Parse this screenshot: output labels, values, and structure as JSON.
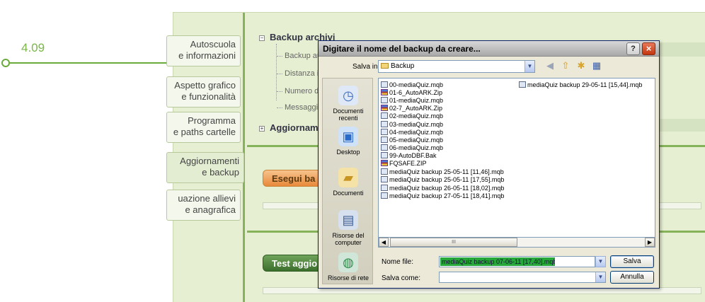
{
  "callout": {
    "label": "4.09"
  },
  "sidebar": {
    "items": [
      {
        "line1": "Autoscuola",
        "line2": "e informazioni"
      },
      {
        "line1": "Aspetto grafico",
        "line2": "e funzionalità"
      },
      {
        "line1": "Programma",
        "line2": "e paths cartelle"
      },
      {
        "line1": "Aggiornamenti",
        "line2": "e backup"
      },
      {
        "line1": "uazione allievi",
        "line2": "e anagrafica"
      }
    ],
    "active_index": 3
  },
  "content": {
    "tree": {
      "group1_title": "Backup archivi",
      "group1_items": [
        "Backup au",
        "Distanza i",
        "Numero di",
        "Messaggio"
      ],
      "group2_title": "Aggiornam"
    },
    "backup_button": "Esegui ba",
    "test_button": "Test aggio"
  },
  "dialog": {
    "title": "Digitare il nome del backup da creare...",
    "help": "?",
    "close": "×",
    "save_in_label": "Salva in:",
    "save_in_value": "Backup",
    "places": [
      "Documenti recenti",
      "Desktop",
      "Documenti",
      "Risorse del computer",
      "Risorse di rete"
    ],
    "files_col1": [
      {
        "name": "00-mediaQuiz.mqb",
        "type": "mqb"
      },
      {
        "name": "01-6_AutoARK.Zip",
        "type": "zip"
      },
      {
        "name": "01-mediaQuiz.mqb",
        "type": "mqb"
      },
      {
        "name": "02-7_AutoARK.Zip",
        "type": "zip"
      },
      {
        "name": "02-mediaQuiz.mqb",
        "type": "mqb"
      },
      {
        "name": "03-mediaQuiz.mqb",
        "type": "mqb"
      },
      {
        "name": "04-mediaQuiz.mqb",
        "type": "mqb"
      },
      {
        "name": "05-mediaQuiz.mqb",
        "type": "mqb"
      },
      {
        "name": "06-mediaQuiz.mqb",
        "type": "mqb"
      },
      {
        "name": "99-AutoDBF.Bak",
        "type": "mqb"
      },
      {
        "name": "FQSAFE.ZIP",
        "type": "zip"
      },
      {
        "name": "mediaQuiz backup 25-05-11 [11,46].mqb",
        "type": "mqb"
      },
      {
        "name": "mediaQuiz backup 25-05-11 [17,55].mqb",
        "type": "mqb"
      },
      {
        "name": "mediaQuiz backup 26-05-11 [18,02].mqb",
        "type": "mqb"
      },
      {
        "name": "mediaQuiz backup 27-05-11 [18,41].mqb",
        "type": "mqb"
      }
    ],
    "files_col2": [
      {
        "name": "mediaQuiz backup 29-05-11 [15,44].mqb",
        "type": "mqb"
      }
    ],
    "scroll_thumb": "III",
    "filename_label": "Nome file:",
    "filename_value": "mediaQuiz backup 07-06-11 [17,40].mqb",
    "savetype_label": "Salva come:",
    "savetype_value": "",
    "save_button": "Salva",
    "cancel_button": "Annulla"
  }
}
